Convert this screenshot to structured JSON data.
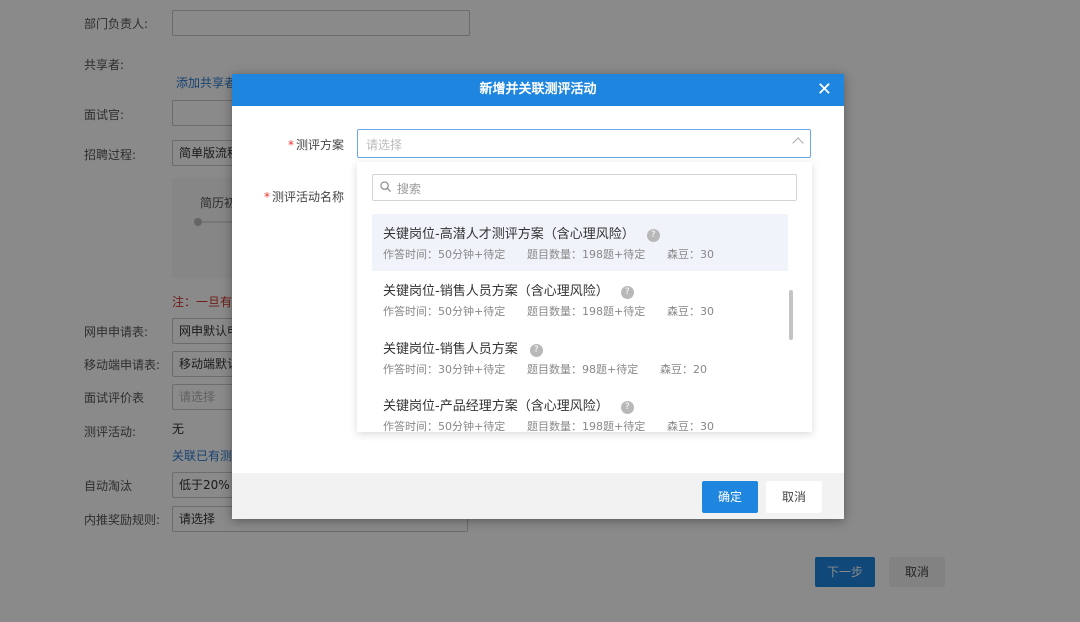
{
  "background_form": {
    "dept_head_label": "部门负责人:",
    "sharer_label": "共享者:",
    "add_sharer_link": "添加共享者",
    "interviewer_label": "面试官:",
    "recruit_process_label": "招聘过程:",
    "recruit_process_value": "简单版流程",
    "flow_step": "简历初",
    "notice": "注：一旦有",
    "online_apply_label": "网申申请表:",
    "online_apply_value": "网申默认申",
    "mobile_apply_label": "移动端申请表:",
    "mobile_apply_value": "移动端默认",
    "interview_eval_label": "面试评价表",
    "interview_eval_placeholder": "请选择",
    "assessment_label": "测评活动:",
    "assessment_value": "无",
    "link_existing": "关联已有测",
    "auto_elim_label": "自动淘汰",
    "auto_elim_value": "低于20%",
    "referral_label": "内推奖励规则:",
    "referral_value": "请选择",
    "next_button": "下一步",
    "cancel_button": "取消"
  },
  "modal": {
    "title": "新增并关联测评活动",
    "close_icon": "close-icon",
    "scheme_label": "测评方案",
    "scheme_placeholder": "请选择",
    "activity_name_label": "测评活动名称",
    "confirm_button": "确定",
    "cancel_button": "取消"
  },
  "dropdown": {
    "search_placeholder": "搜索",
    "options": [
      {
        "title": "关键岗位-高潜人才测评方案（含心理风险）",
        "time": "作答时间：50分钟+待定",
        "count": "题目数量：198题+待定",
        "beans": "森豆：30"
      },
      {
        "title": "关键岗位-销售人员方案（含心理风险）",
        "time": "作答时间：50分钟+待定",
        "count": "题目数量：198题+待定",
        "beans": "森豆：30"
      },
      {
        "title": "关键岗位-销售人员方案",
        "time": "作答时间：30分钟+待定",
        "count": "题目数量：98题+待定",
        "beans": "森豆：20"
      },
      {
        "title": "关键岗位-产品经理方案（含心理风险）",
        "time": "作答时间：50分钟+待定",
        "count": "题目数量：198题+待定",
        "beans": "森豆：30"
      }
    ]
  },
  "colors": {
    "primary": "#1f86e0",
    "required": "#e33333",
    "link": "#2b7cd3",
    "warning": "#d0342c"
  }
}
